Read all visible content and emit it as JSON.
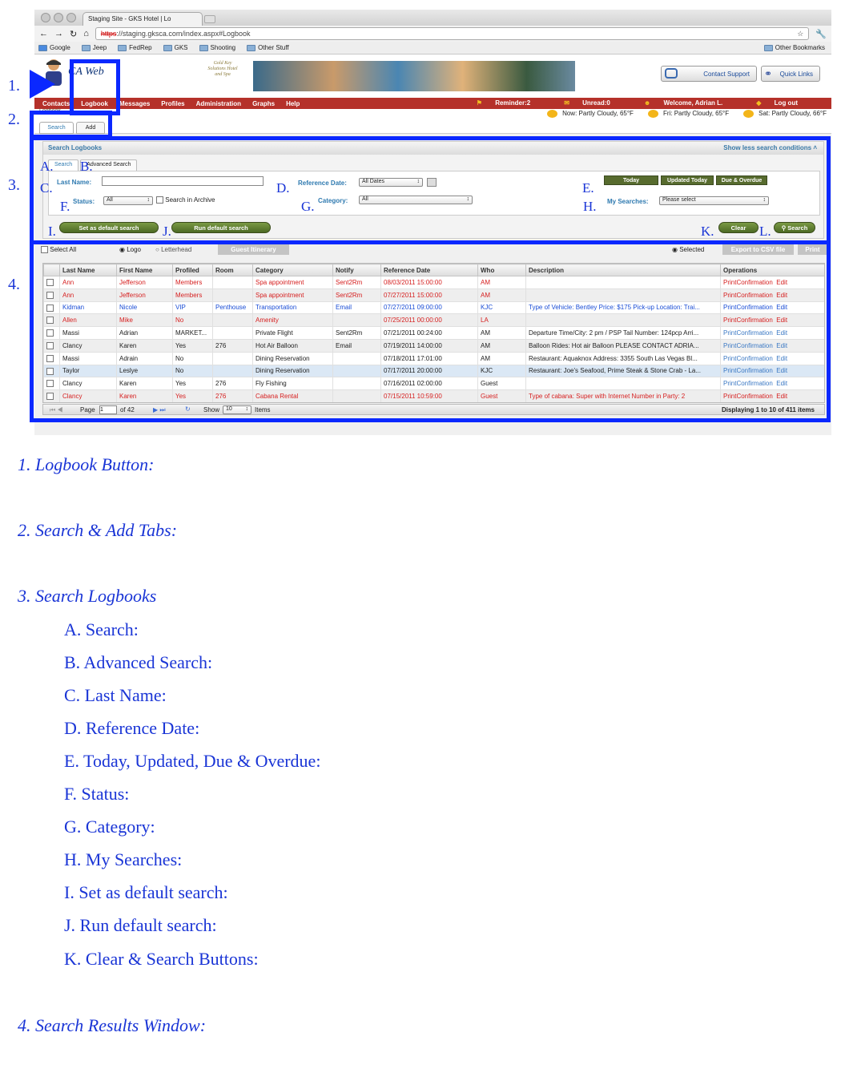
{
  "browser": {
    "tab_title": "Staging Site - GKS Hotel | Lo",
    "url_scheme": "https",
    "url_rest": "://staging.gksca.com/index.aspx#Logbook",
    "bookmarks": [
      "Google",
      "Jeep",
      "FedRep",
      "GKS",
      "Shooting",
      "Other Stuff"
    ],
    "other_bookmarks": "Other Bookmarks"
  },
  "header": {
    "logo": "CA Web",
    "hotel_name": "Gold Key Solutions Hotel and Spa",
    "contact_support": "Contact Support",
    "quick_links": "Quick Links"
  },
  "menu": {
    "items": [
      "Contacts",
      "Logbook",
      "Messages",
      "Profiles",
      "Administration",
      "Graphs",
      "Help"
    ],
    "reminder": "Reminder:2",
    "unread": "Unread:0",
    "welcome": "Welcome, Adrian L.",
    "logout": "Log out"
  },
  "weather": {
    "now": "Now: Partly Cloudy, 65°F",
    "fri": "Fri: Partly Cloudy, 65°F",
    "sat": "Sat: Partly Cloudy, 66°F"
  },
  "breadcrumb": "Logbook",
  "tabs": {
    "search": "Search",
    "add": "Add"
  },
  "search_panel": {
    "title": "Search Logbooks",
    "toggle": "Show less search conditions",
    "subtab_search": "Search",
    "subtab_advanced": "Advanced Search",
    "last_name_label": "Last Name:",
    "last_name_value": "",
    "search_in_archive": "Search in Archive",
    "status_label": "Status:",
    "status_value": "All",
    "ref_date_label": "Reference Date:",
    "ref_date_value": "All Dates",
    "category_label": "Category:",
    "category_value": "All",
    "today": "Today",
    "updated_today": "Updated Today",
    "due_overdue": "Due & Overdue",
    "my_searches_label": "My Searches:",
    "my_searches_value": "Please select",
    "set_default": "Set as default search",
    "run_default": "Run default search",
    "clear": "Clear",
    "search": "Search"
  },
  "results_bar": {
    "select_all": "Select All",
    "logo": "Logo",
    "letterhead": "Letterhead",
    "guest_itinerary": "Guest Itinerary",
    "selected": "Selected",
    "export_csv": "Export to CSV file",
    "print": "Print"
  },
  "table": {
    "columns": [
      "Last Name",
      "First Name",
      "Profiled",
      "Room",
      "Category",
      "Notify",
      "Reference Date",
      "Who",
      "Description",
      "Operations"
    ],
    "ops_print": "PrintConfirmation",
    "ops_edit": "Edit",
    "rows": [
      {
        "last": "Ann",
        "first": "Jefferson",
        "profiled": "Members",
        "room": "",
        "category": "Spa appointment",
        "notify": "Sent2Rm",
        "date": "08/03/2011 15:00:00",
        "who": "AM",
        "desc": "",
        "style": "red"
      },
      {
        "last": "Ann",
        "first": "Jefferson",
        "profiled": "Members",
        "room": "",
        "category": "Spa appointment",
        "notify": "Sent2Rm",
        "date": "07/27/2011 15:00:00",
        "who": "AM",
        "desc": "",
        "style": "red alt"
      },
      {
        "last": "Kidman",
        "first": "Nicole",
        "profiled": "VIP",
        "room": "Penthouse",
        "category": "Transportation",
        "notify": "Email",
        "date": "07/27/2011 09:00:00",
        "who": "KJC",
        "desc": "Type of Vehicle: Bentley Price: $175 Pick-up Location: Trai...",
        "style": "blue"
      },
      {
        "last": "Allen",
        "first": "Mike",
        "profiled": "No",
        "room": "",
        "category": "Amenity",
        "notify": "",
        "date": "07/25/2011 00:00:00",
        "who": "LA",
        "desc": "",
        "style": "red alt"
      },
      {
        "last": "Massi",
        "first": "Adrian",
        "profiled": "MARKET...",
        "room": "",
        "category": "Private Flight",
        "notify": "Sent2Rm",
        "date": "07/21/2011 00:24:00",
        "who": "AM",
        "desc": "Departure Time/City: 2 pm / PSP Tail Number: 124pcp Arri...",
        "style": ""
      },
      {
        "last": "Clancy",
        "first": "Karen",
        "profiled": "Yes",
        "room": "276",
        "category": "Hot Air Balloon",
        "notify": "Email",
        "date": "07/19/2011 14:00:00",
        "who": "AM",
        "desc": "Balloon Rides: Hot air Balloon PLEASE CONTACT ADRIA...",
        "style": "alt"
      },
      {
        "last": "Massi",
        "first": "Adrain",
        "profiled": "No",
        "room": "",
        "category": "Dining Reservation",
        "notify": "",
        "date": "07/18/2011 17:01:00",
        "who": "AM",
        "desc": "Restaurant: Aquaknox Address: 3355 South Las Vegas Bl...",
        "style": ""
      },
      {
        "last": "Taylor",
        "first": "Leslye",
        "profiled": "No",
        "room": "",
        "category": "Dining Reservation",
        "notify": "",
        "date": "07/17/2011 20:00:00",
        "who": "KJC",
        "desc": "Restaurant: Joe's Seafood, Prime Steak & Stone Crab - La...",
        "style": "hl"
      },
      {
        "last": "Clancy",
        "first": "Karen",
        "profiled": "Yes",
        "room": "276",
        "category": "Fly Fishing",
        "notify": "",
        "date": "07/16/2011 02:00:00",
        "who": "Guest",
        "desc": "",
        "style": ""
      },
      {
        "last": "Clancy",
        "first": "Karen",
        "profiled": "Yes",
        "room": "276",
        "category": "Cabana Rental",
        "notify": "",
        "date": "07/15/2011 10:59:00",
        "who": "Guest",
        "desc": "Type of cabana: Super with Internet Number in Party: 2",
        "style": "red alt"
      }
    ]
  },
  "pager": {
    "page_label": "Page",
    "page_value": "1",
    "of": "of 42",
    "show_label": "Show",
    "show_value": "10",
    "items_label": "Items",
    "displaying": "Displaying 1 to 10 of 411 items"
  },
  "annotations": {
    "num1": "1.",
    "num2": "2.",
    "num3": "3.",
    "num4": "4.",
    "A": "A.",
    "B": "B.",
    "C": "C.",
    "D": "D.",
    "E": "E.",
    "F": "F.",
    "G": "G.",
    "H": "H.",
    "I": "I.",
    "J": "J.",
    "K": "K.",
    "L": "L."
  },
  "notes": [
    "1. Logbook Button:",
    "2. Search & Add Tabs:",
    "3. Search Logbooks",
    "A. Search:",
    "B.  Advanced Search:",
    "C.  Last Name:",
    "D.  Reference Date:",
    "E.  Today, Updated, Due & Overdue:",
    "F.  Status:",
    "G. Category:",
    "H. My Searches:",
    "I.  Set as default search:",
    "J.  Run default search:",
    "K. Clear & Search Buttons:",
    "4. Search Results Window:"
  ],
  "colors": {
    "menu_red": "#b5312a",
    "annotation_blue": "#0a28ff",
    "row_red": "#d62020",
    "row_blue": "#1a4dd6"
  }
}
